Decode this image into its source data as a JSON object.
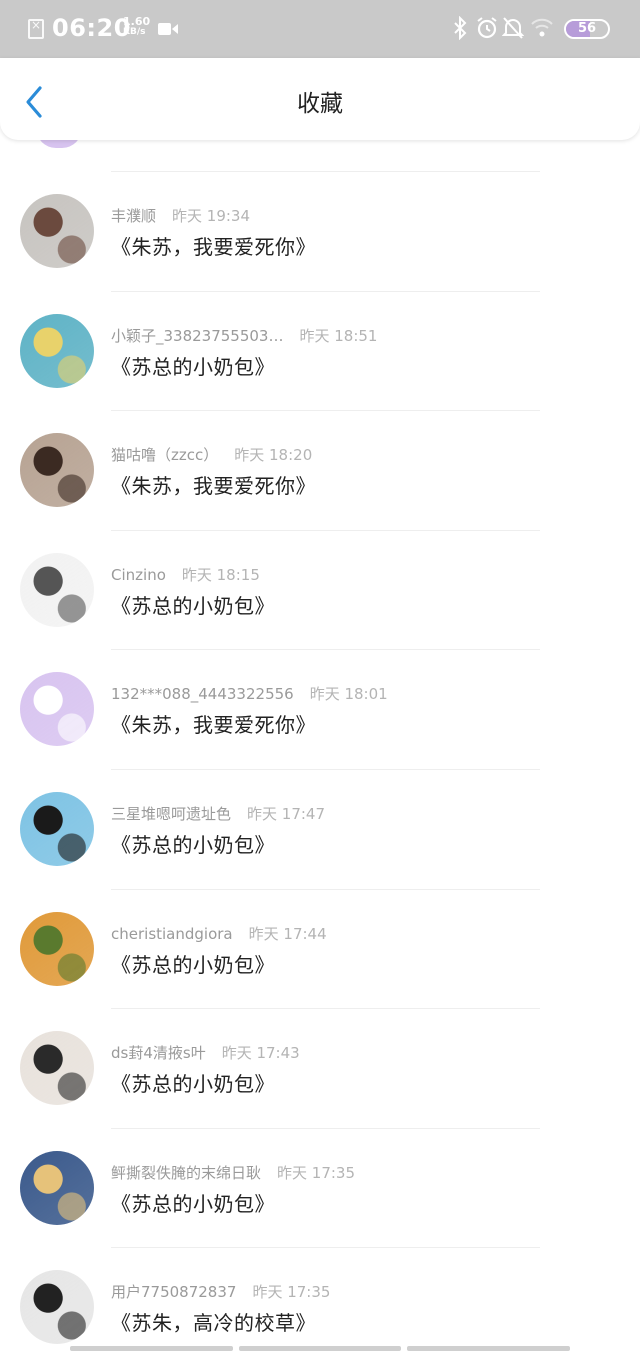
{
  "status_bar": {
    "time": "06:20",
    "speed_value": "1.60",
    "speed_unit": "KB/s",
    "battery": "56",
    "battery_level": 0.56
  },
  "header": {
    "title": "收藏"
  },
  "items": [
    {
      "user": "丰濮顺",
      "time": "昨天 19:34",
      "book": "《朱苏，我要爱死你》",
      "avatar_colors": [
        "#c7c4c0",
        "#6b4a3e"
      ]
    },
    {
      "user": "小颖子_33823755503…",
      "time": "昨天 18:51",
      "book": "《苏总的小奶包》",
      "avatar_colors": [
        "#5fb3c6",
        "#e8d26b"
      ]
    },
    {
      "user": "猫咕噜（zzcc）",
      "time": "昨天 18:20",
      "book": "《朱苏，我要爱死你》",
      "avatar_colors": [
        "#b7a393",
        "#3b2a22"
      ]
    },
    {
      "user": "Cinzino",
      "time": "昨天 18:15",
      "book": "《苏总的小奶包》",
      "avatar_colors": [
        "#f2f2f2",
        "#555555"
      ]
    },
    {
      "user": "132***088_4443322556",
      "time": "昨天 18:01",
      "book": "《朱苏，我要爱死你》",
      "avatar_colors": [
        "#d8c4f0",
        "#ffffff"
      ]
    },
    {
      "user": "三星堆嗯呵遗址色",
      "time": "昨天 17:47",
      "book": "《苏总的小奶包》",
      "avatar_colors": [
        "#7ec3e4",
        "#1a1a1a"
      ]
    },
    {
      "user": "cheristiandgiora",
      "time": "昨天 17:44",
      "book": "《苏总的小奶包》",
      "avatar_colors": [
        "#e09a3a",
        "#5a7a2e"
      ]
    },
    {
      "user": "ds葑4清掖s叶",
      "time": "昨天 17:43",
      "book": "《苏总的小奶包》",
      "avatar_colors": [
        "#e8e2dc",
        "#2a2a2a"
      ]
    },
    {
      "user": "鲆撕裂佚腌的末绵日耿",
      "time": "昨天 17:35",
      "book": "《苏总的小奶包》",
      "avatar_colors": [
        "#3b5a8c",
        "#e6c27a"
      ]
    },
    {
      "user": "用户7750872837",
      "time": "昨天 17:35",
      "book": "《苏朱，高冷的校草》",
      "avatar_colors": [
        "#e6e6e6",
        "#222222"
      ]
    }
  ]
}
